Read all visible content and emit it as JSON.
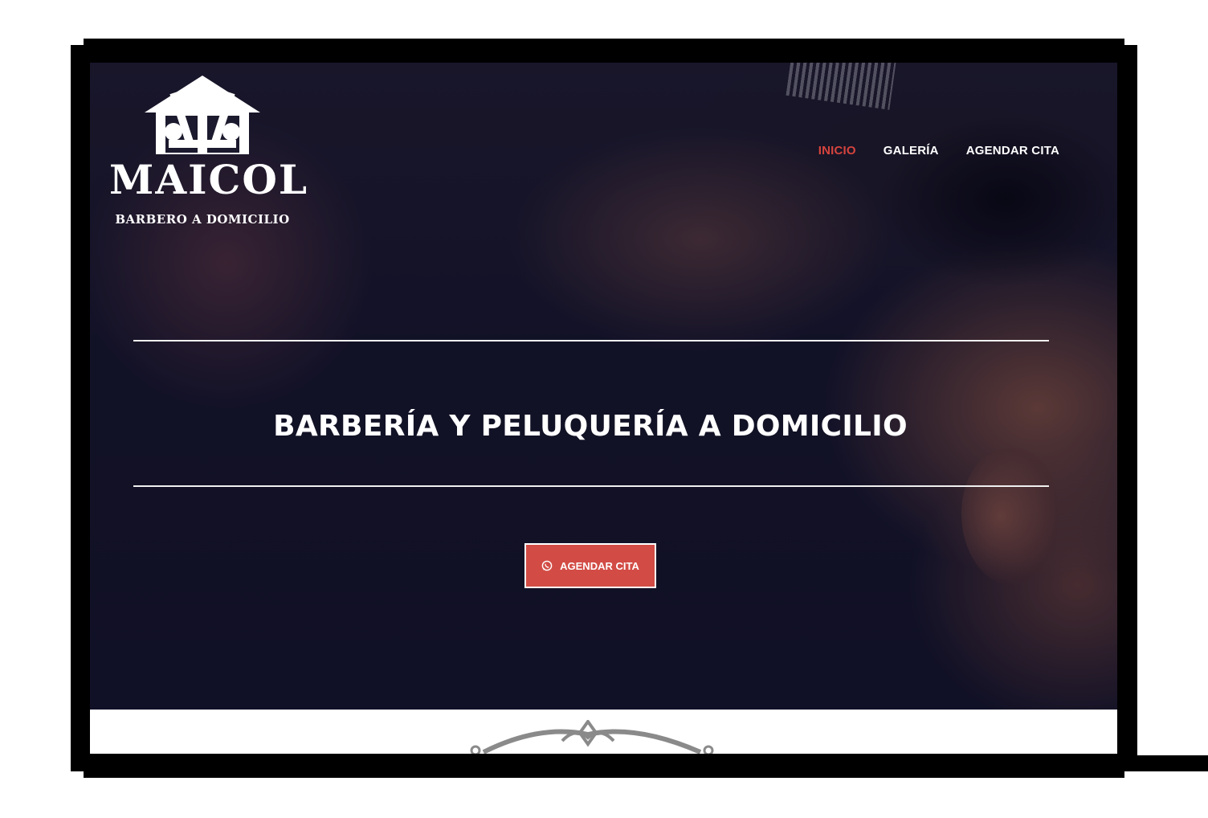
{
  "brand": {
    "name": "MAICOL",
    "tagline": "BARBERO A DOMICILIO"
  },
  "nav": {
    "items": [
      {
        "label": "INICIO",
        "active": true
      },
      {
        "label": "GALERÍA",
        "active": false
      },
      {
        "label": "AGENDAR CITA",
        "active": false
      }
    ]
  },
  "hero": {
    "headline": "BARBERÍA Y PELUQUERÍA A DOMICILIO",
    "cta": {
      "label": "AGENDAR CITA",
      "icon": "whatsapp-icon"
    }
  },
  "colors": {
    "accent": "#d24c45",
    "active_nav": "#d6443d",
    "text": "#ffffff"
  }
}
